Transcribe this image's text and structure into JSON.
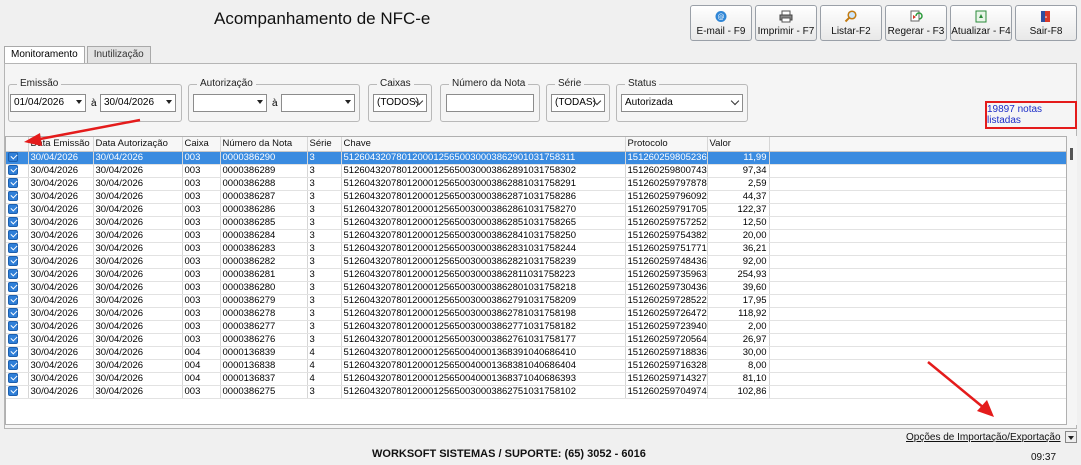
{
  "window": {
    "title": "Acompanhamento de NFC-e"
  },
  "toolbar": {
    "buttons": [
      {
        "label": "E-mail - F9",
        "icon": "email-icon"
      },
      {
        "label": "Imprimir - F7",
        "icon": "printer-icon"
      },
      {
        "label": "Listar-F2",
        "icon": "search-icon"
      },
      {
        "label": "Regerar - F3",
        "icon": "regenerate-icon"
      },
      {
        "label": "Atualizar - F4",
        "icon": "refresh-icon"
      },
      {
        "label": "Sair-F8",
        "icon": "exit-door-icon"
      }
    ]
  },
  "tabs": [
    {
      "label": "Monitoramento",
      "active": true
    },
    {
      "label": "Inutilização",
      "active": false
    }
  ],
  "filters": {
    "emissao": {
      "label": "Emissão",
      "from": "01/04/2026",
      "to": "30/04/2026",
      "sep": "à"
    },
    "autorizacao": {
      "label": "Autorização",
      "from": "",
      "to": "",
      "sep": "à"
    },
    "caixas": {
      "label": "Caixas",
      "value": "(TODOS)"
    },
    "numero_nota": {
      "label": "Número da Nota",
      "value": ""
    },
    "serie": {
      "label": "Série",
      "value": "(TODAS)"
    },
    "status": {
      "label": "Status",
      "value": "Autorizada"
    }
  },
  "count_label": "19897 notas listadas",
  "table": {
    "columns": [
      "Data Emissão",
      "Data Autorização",
      "Caixa",
      "Número da Nota",
      "Série",
      "Chave",
      "Protocolo",
      "Valor"
    ],
    "rows": [
      [
        "30/04/2026",
        "30/04/2026",
        "003",
        "0000386290",
        "3",
        "51260432078012000125650030003862901031758311",
        "151260259805236",
        "11,99"
      ],
      [
        "30/04/2026",
        "30/04/2026",
        "003",
        "0000386289",
        "3",
        "51260432078012000125650030003862891031758302",
        "151260259800743",
        "97,34"
      ],
      [
        "30/04/2026",
        "30/04/2026",
        "003",
        "0000386288",
        "3",
        "51260432078012000125650030003862881031758291",
        "151260259797878",
        "2,59"
      ],
      [
        "30/04/2026",
        "30/04/2026",
        "003",
        "0000386287",
        "3",
        "51260432078012000125650030003862871031758286",
        "151260259796092",
        "44,37"
      ],
      [
        "30/04/2026",
        "30/04/2026",
        "003",
        "0000386286",
        "3",
        "51260432078012000125650030003862861031758270",
        "151260259791705",
        "122,37"
      ],
      [
        "30/04/2026",
        "30/04/2026",
        "003",
        "0000386285",
        "3",
        "51260432078012000125650030003862851031758265",
        "151260259757252",
        "12,50"
      ],
      [
        "30/04/2026",
        "30/04/2026",
        "003",
        "0000386284",
        "3",
        "51260432078012000125650030003862841031758250",
        "151260259754382",
        "20,00"
      ],
      [
        "30/04/2026",
        "30/04/2026",
        "003",
        "0000386283",
        "3",
        "51260432078012000125650030003862831031758244",
        "151260259751771",
        "36,21"
      ],
      [
        "30/04/2026",
        "30/04/2026",
        "003",
        "0000386282",
        "3",
        "51260432078012000125650030003862821031758239",
        "151260259748436",
        "92,00"
      ],
      [
        "30/04/2026",
        "30/04/2026",
        "003",
        "0000386281",
        "3",
        "51260432078012000125650030003862811031758223",
        "151260259735963",
        "254,93"
      ],
      [
        "30/04/2026",
        "30/04/2026",
        "003",
        "0000386280",
        "3",
        "51260432078012000125650030003862801031758218",
        "151260259730436",
        "39,60"
      ],
      [
        "30/04/2026",
        "30/04/2026",
        "003",
        "0000386279",
        "3",
        "51260432078012000125650030003862791031758209",
        "151260259728522",
        "17,95"
      ],
      [
        "30/04/2026",
        "30/04/2026",
        "003",
        "0000386278",
        "3",
        "51260432078012000125650030003862781031758198",
        "151260259726472",
        "118,92"
      ],
      [
        "30/04/2026",
        "30/04/2026",
        "003",
        "0000386277",
        "3",
        "51260432078012000125650030003862771031758182",
        "151260259723940",
        "2,00"
      ],
      [
        "30/04/2026",
        "30/04/2026",
        "003",
        "0000386276",
        "3",
        "51260432078012000125650030003862761031758177",
        "151260259720564",
        "26,97"
      ],
      [
        "30/04/2026",
        "30/04/2026",
        "004",
        "0000136839",
        "4",
        "51260432078012000125650040001368391040686410",
        "151260259718836",
        "30,00"
      ],
      [
        "30/04/2026",
        "30/04/2026",
        "004",
        "0000136838",
        "4",
        "51260432078012000125650040001368381040686404",
        "151260259716328",
        "8,00"
      ],
      [
        "30/04/2026",
        "30/04/2026",
        "004",
        "0000136837",
        "4",
        "51260432078012000125650040001368371040686393",
        "151260259714327",
        "81,10"
      ],
      [
        "30/04/2026",
        "30/04/2026",
        "003",
        "0000386275",
        "3",
        "51260432078012000125650030003862751031758102",
        "151260259704974",
        "102,86"
      ]
    ]
  },
  "import_export_label": "Opções de Importação/Exportação",
  "footer_text": "WORKSOFT SISTEMAS / SUPORTE: (65) 3052 - 6016",
  "clock": "09:37",
  "colors": {
    "selection": "#3a8be0",
    "annotation_red": "#e41b1b",
    "count_text": "#1d2ec8"
  }
}
